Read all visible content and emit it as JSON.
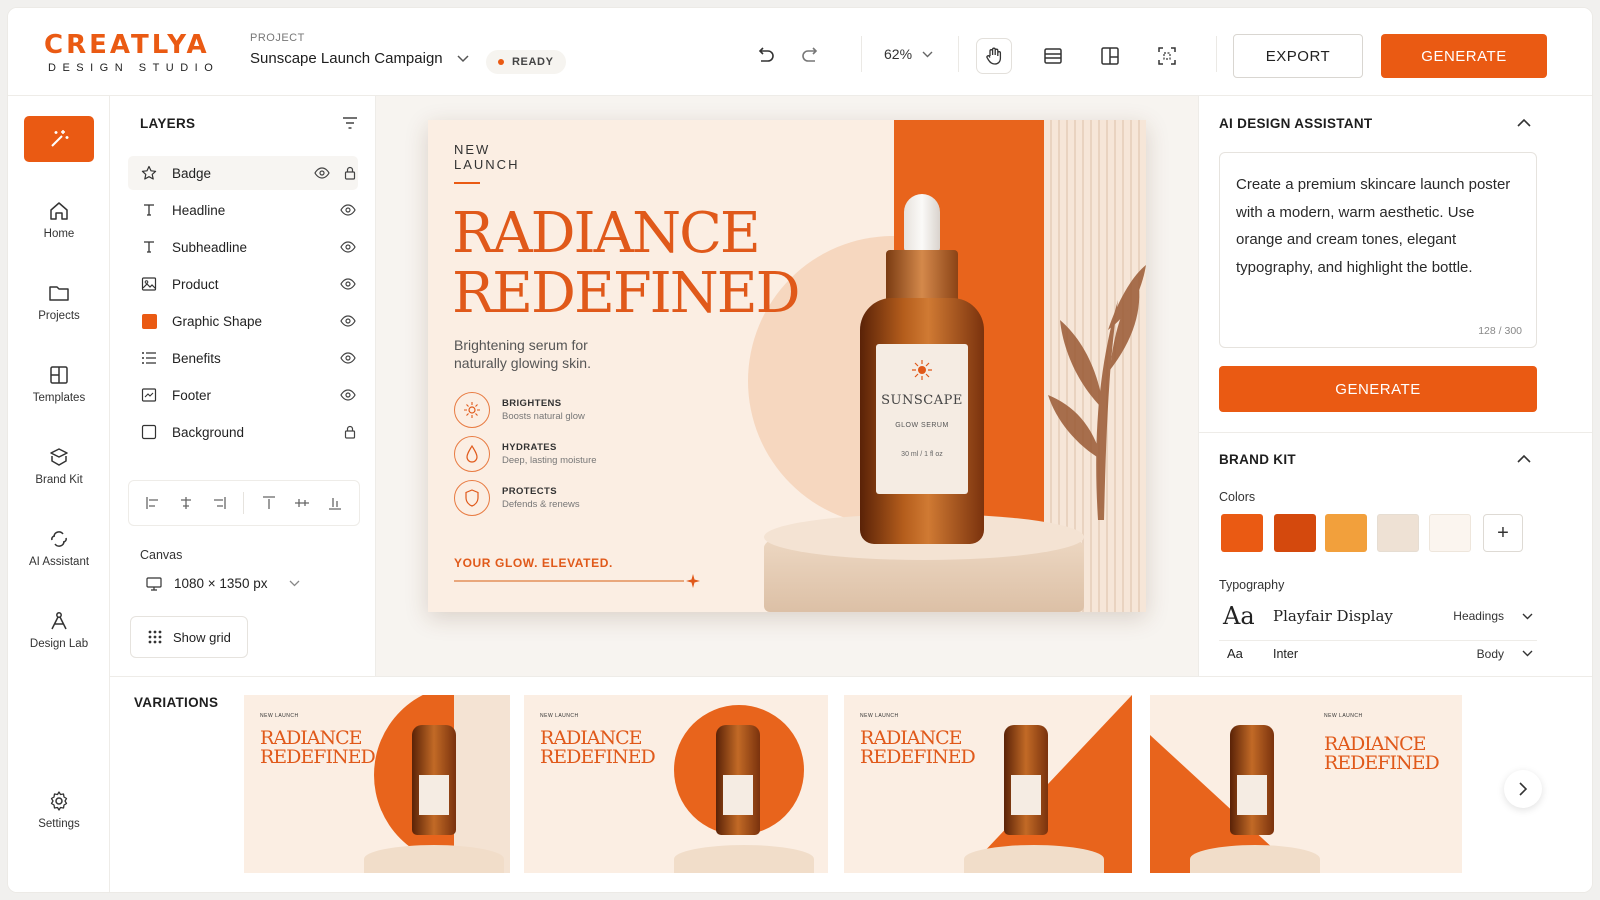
{
  "brand": {
    "name": "CREATLYA",
    "tagline": "DESIGN STUDIO",
    "accent": "#ea5a13"
  },
  "project": {
    "label": "PROJECT",
    "name": "Sunscape Launch Campaign",
    "status": "READY"
  },
  "toolbar": {
    "zoom": "62%",
    "export_label": "EXPORT",
    "generate_label": "GENERATE",
    "icons": [
      "undo-icon",
      "redo-icon",
      "hand-tool-icon",
      "layout-icon",
      "resize-icon",
      "crop-icon"
    ]
  },
  "nav": {
    "items": [
      {
        "label": "Home",
        "icon": "home-icon"
      },
      {
        "label": "Projects",
        "icon": "folder-icon"
      },
      {
        "label": "Templates",
        "icon": "templates-icon"
      },
      {
        "label": "Brand Kit",
        "icon": "brand-kit-icon"
      },
      {
        "label": "AI Assistant",
        "icon": "ai-assistant-icon"
      },
      {
        "label": "Design Lab",
        "icon": "design-lab-icon"
      }
    ],
    "settings_label": "Settings"
  },
  "layers": {
    "title": "LAYERS",
    "items": [
      {
        "label": "Badge",
        "icon": "star-icon"
      },
      {
        "label": "Headline",
        "icon": "text-icon"
      },
      {
        "label": "Subheadline",
        "icon": "text-icon"
      },
      {
        "label": "Product",
        "icon": "image-icon"
      },
      {
        "label": "Graphic Shape",
        "icon": "shape-icon"
      },
      {
        "label": "Benefits",
        "icon": "list-icon"
      },
      {
        "label": "Footer",
        "icon": "footer-icon"
      },
      {
        "label": "Background",
        "icon": "square-icon"
      }
    ],
    "canvas_label": "Canvas",
    "canvas_size": "1080 × 1350 px",
    "show_grid_label": "Show grid"
  },
  "poster": {
    "badge": "NEW LAUNCH",
    "headline": "RADIANCE\nREDEFINED",
    "subheadline": "Brightening serum for naturally glowing skin.",
    "benefits": [
      {
        "title": "BRIGHTENS",
        "desc": "Boosts natural glow"
      },
      {
        "title": "HYDRATES",
        "desc": "Deep, lasting moisture"
      },
      {
        "title": "PROTECTS",
        "desc": "Defends & renews"
      }
    ],
    "footer": "YOUR GLOW. ELEVATED.",
    "bottle_brand": "SUNSCAPE",
    "bottle_product": "GLOW SERUM",
    "bottle_volume": "30 ml / 1 fl oz"
  },
  "ai_assistant": {
    "title": "AI DESIGN ASSISTANT",
    "prompt": "Create a premium skincare launch poster with a modern, warm aesthetic. Use orange and cream tones, elegant typography, and highlight the bottle.",
    "char_count": "128 / 300",
    "generate_label": "GENERATE"
  },
  "brand_kit": {
    "title": "BRAND KIT",
    "colors_label": "Colors",
    "colors": [
      "#ea5a13",
      "#d4490d",
      "#f2a03c",
      "#eee1d4",
      "#fbf5ef"
    ],
    "typography_label": "Typography",
    "fonts": [
      {
        "sample": "Aa",
        "name": "Playfair Display",
        "role": "Headings"
      },
      {
        "sample": "Aa",
        "name": "Inter",
        "role": "Body"
      }
    ]
  },
  "variations": {
    "title": "VARIATIONS",
    "cards": [
      {
        "badge": "NEW LAUNCH",
        "headline": "RADIANCE\nREDEFINED"
      },
      {
        "badge": "NEW LAUNCH",
        "headline": "RADIANCE\nREDEFINED"
      },
      {
        "badge": "NEW LAUNCH",
        "headline": "RADIANCE\nREDEFINED"
      },
      {
        "badge": "NEW LAUNCH",
        "headline": "RADIANCE\nREDEFINED"
      }
    ]
  }
}
